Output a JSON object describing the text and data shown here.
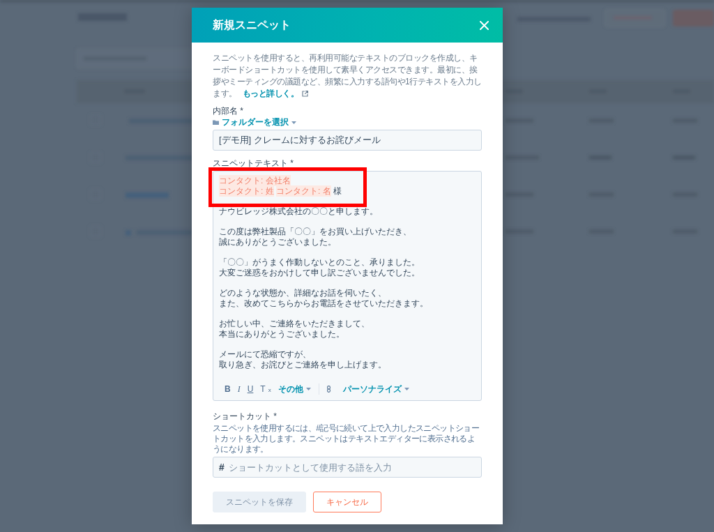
{
  "modal": {
    "title": "新規スニペット"
  },
  "description": {
    "text": "スニペットを使用すると、再利用可能なテキストのブロックを作成し、キーボードショートカットを使用して素早くアクセスできます。最初に、挨拶やミーティングの議題など、頻繁に入力する語句や1行テキストを入力します。",
    "link": "もっと詳しく。"
  },
  "internal_name": {
    "label": "内部名 *",
    "folder": "フォルダーを選択",
    "value": "[デモ用] クレームに対するお詫びメール"
  },
  "snippet_text": {
    "label": "スニペットテキスト *",
    "paragraphs": [
      {
        "highlighted": true,
        "lines": [
          [
            {
              "kind": "token",
              "text": "コンタクト: 会社名"
            }
          ],
          [
            {
              "kind": "token",
              "text": "コンタクト: 姓"
            },
            {
              "kind": "token",
              "text": "コンタクト: 名"
            },
            {
              "kind": "text",
              "text": "様"
            }
          ]
        ]
      },
      {
        "highlighted": false,
        "lines": [
          [
            {
              "kind": "text",
              "text": "ナウビレッジ株式会社の〇〇と申します。"
            }
          ]
        ]
      },
      {
        "highlighted": false,
        "lines": [
          [
            {
              "kind": "text",
              "text": "この度は弊社製品「〇〇」をお買い上げいただき、"
            }
          ],
          [
            {
              "kind": "text",
              "text": "誠にありがとうございました。"
            }
          ]
        ]
      },
      {
        "highlighted": false,
        "lines": [
          [
            {
              "kind": "text",
              "text": "「〇〇」がうまく作動しないとのこと、承りました。"
            }
          ],
          [
            {
              "kind": "text",
              "text": "大変ご迷惑をおかけして申し訳ございませんでした。"
            }
          ]
        ]
      },
      {
        "highlighted": false,
        "lines": [
          [
            {
              "kind": "text",
              "text": "どのような状態か、詳細なお話を伺いたく、"
            }
          ],
          [
            {
              "kind": "text",
              "text": "また、改めてこちらからお電話をさせていただきます。"
            }
          ]
        ]
      },
      {
        "highlighted": false,
        "lines": [
          [
            {
              "kind": "text",
              "text": "お忙しい中、ご連絡をいただきまして、"
            }
          ],
          [
            {
              "kind": "text",
              "text": "本当にありがとうございました。"
            }
          ]
        ]
      },
      {
        "highlighted": false,
        "lines": [
          [
            {
              "kind": "text",
              "text": "メールにて恐縮ですが、"
            }
          ],
          [
            {
              "kind": "text",
              "text": "取り急ぎ、お詫びとご連絡を申し上げます。"
            }
          ]
        ]
      }
    ],
    "toolbar": [
      {
        "kind": "bold",
        "label": "B"
      },
      {
        "kind": "italic",
        "label": "I"
      },
      {
        "kind": "underline",
        "label": "U"
      },
      {
        "kind": "clear",
        "label": "T$_{x}$"
      },
      {
        "kind": "menu",
        "label": "その他"
      },
      {
        "kind": "divider"
      },
      {
        "kind": "link"
      },
      {
        "kind": "menu",
        "label": "パーソナライズ"
      }
    ]
  },
  "shortcut": {
    "label": "ショートカット *",
    "help": "スニペットを使用するには、#記号に続いて上で入力したスニペットショートカットを入力します。スニペットはテキストエディターに表示されるようになります。",
    "prefix": "#",
    "placeholder": "ショートカットとして使用する語を入力"
  },
  "buttons": [
    {
      "kind": "primary",
      "label": "スニペットを保存",
      "disabled": true
    },
    {
      "kind": "secondary",
      "label": "キャンセル",
      "disabled": false
    }
  ]
}
